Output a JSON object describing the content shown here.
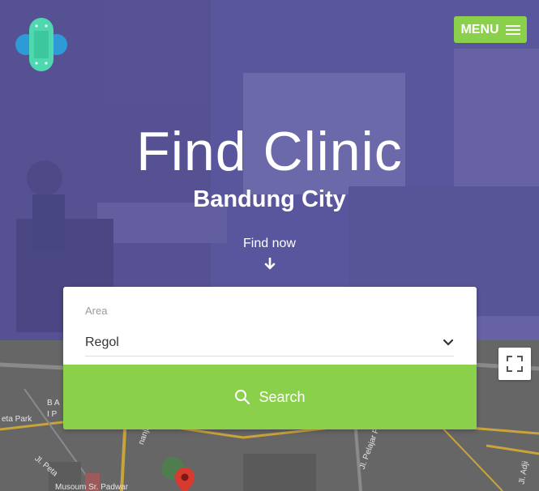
{
  "header": {
    "menu_label": "MENU"
  },
  "hero": {
    "title": "Find Clinic",
    "subtitle": "Bandung City",
    "find_now": "Find now"
  },
  "search": {
    "area_label": "Area",
    "area_value": "Regol",
    "button_label": "Search"
  },
  "map": {
    "labels": [
      "B A",
      "I P",
      "eta Park",
      "Jl. Peta",
      "nanjar",
      "Jl. Pelajar Peju",
      "Jl. Adji",
      "Musoum Sr. Padwar"
    ]
  },
  "colors": {
    "accent_green": "#8bd04a",
    "hero_overlay": "#524e96",
    "logo_teal": "#4fd8b0",
    "logo_blue": "#2f9bd6",
    "map_pin": "#d93a2f"
  },
  "icons": [
    "bandage-logo",
    "hamburger-icon",
    "arrow-down-icon",
    "chevron-down-icon",
    "search-icon",
    "fullscreen-icon",
    "map-pin-icon"
  ]
}
